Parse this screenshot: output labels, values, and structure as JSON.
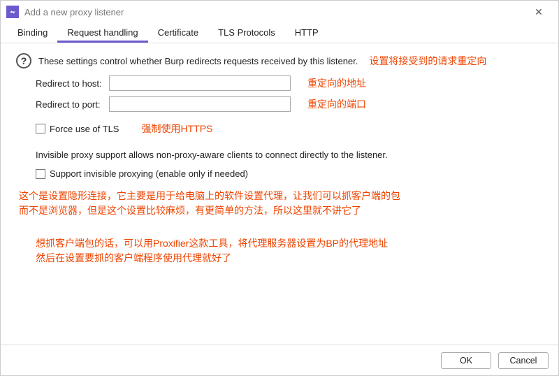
{
  "window": {
    "title": "Add a new proxy listener"
  },
  "tabs": [
    {
      "label": "Binding"
    },
    {
      "label": "Request handling"
    },
    {
      "label": "Certificate"
    },
    {
      "label": "TLS Protocols"
    },
    {
      "label": "HTTP"
    }
  ],
  "active_tab_index": 1,
  "desc": "These settings control whether Burp redirects requests received by this listener.",
  "annotations": {
    "desc": "设置将接受到的请求重定向",
    "host": "重定向的地址",
    "port": "重定向的端口",
    "tls": "强制使用HTTPS",
    "invisible1": "这个是设置隐形连接，它主要是用于给电脑上的软件设置代理，让我们可以抓客户端的包",
    "invisible2": "而不是浏览器，但是这个设置比较麻烦，有更简单的方法，所以这里就不讲它了",
    "proxifier1": "想抓客户端包的话，可以用Proxifier这款工具，将代理服务器设置为BP的代理地址",
    "proxifier2": "然后在设置要抓的客户端程序使用代理就好了"
  },
  "fields": {
    "host_label": "Redirect to host:",
    "host_value": "",
    "port_label": "Redirect to port:",
    "port_value": ""
  },
  "checkboxes": {
    "force_tls": "Force use of TLS",
    "invisible_desc": "Invisible proxy support allows non-proxy-aware clients to connect directly to the listener.",
    "invisible_label": "Support invisible proxying (enable only if needed)"
  },
  "buttons": {
    "ok": "OK",
    "cancel": "Cancel"
  }
}
